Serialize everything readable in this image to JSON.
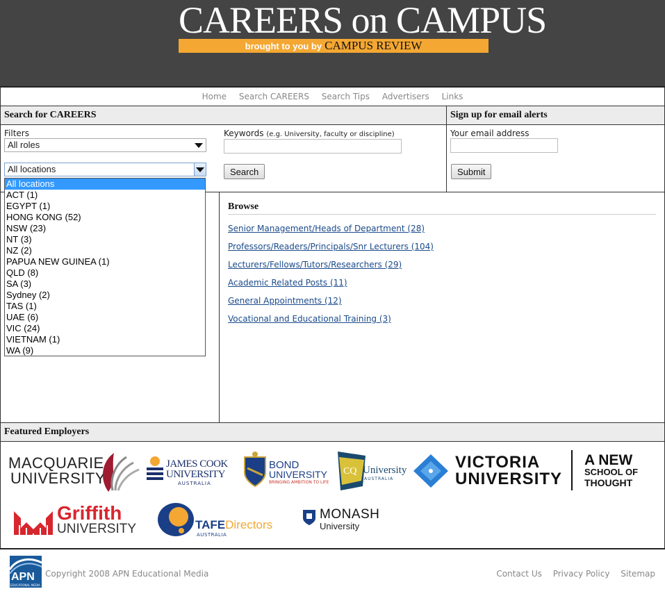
{
  "header": {
    "logo_title": "CAREERS on CAMPUS",
    "logo_subtitle": "brought to you by",
    "logo_brand": "CAMPUS REVIEW",
    "bg_color": "#444444",
    "bar_color": "#f4a732"
  },
  "nav": {
    "items": [
      "Home",
      "Search CAREERS",
      "Search Tips",
      "Advertisers",
      "Links"
    ]
  },
  "search": {
    "heading": "Search for CAREERS",
    "filters_label": "Filters",
    "roles_value": "All roles",
    "locations_value": "All locations",
    "keywords_label": "Keywords",
    "keywords_hint": "(e.g. University, faculty or discipline)",
    "keywords_value": "",
    "search_button": "Search",
    "location_options": [
      "All locations",
      "ACT (1)",
      "EGYPT (1)",
      "HONG KONG (52)",
      "NSW (23)",
      "NT (3)",
      "NZ (2)",
      "PAPUA NEW GUINEA (1)",
      "QLD (8)",
      "SA (3)",
      "Sydney (2)",
      "TAS (1)",
      "UAE (6)",
      "VIC (24)",
      "VIETNAM (1)",
      "WA (9)"
    ]
  },
  "alerts": {
    "heading": "Sign up for email alerts",
    "email_label": "Your email address",
    "email_value": "",
    "submit_button": "Submit"
  },
  "browse": {
    "heading": "Browse",
    "links": [
      "Senior Management/Heads of Department (28)",
      "Professors/Readers/Principals/Snr Lecturers (104)",
      "Lecturers/Fellows/Tutors/Researchers (29)",
      "Academic Related Posts (11)",
      "General Appointments (12)",
      "Vocational and Educational Training (3)"
    ]
  },
  "employers": {
    "heading": "Featured Employers",
    "macquarie": [
      "MACQUARIE",
      "UNIVERSITY"
    ],
    "jcu": [
      "JAMES COOK",
      "UNIVERSITY",
      "AUSTRALIA"
    ],
    "bond": [
      "BOND",
      "UNIVERSITY",
      "BRINGING AMBITION TO LIFE"
    ],
    "cqu": [
      "CQ",
      "University",
      "AUSTRALIA"
    ],
    "victoria": [
      "VICTORIA",
      "UNIVERSITY",
      "A NEW",
      "SCHOOL OF",
      "THOUGHT"
    ],
    "griffith": [
      "Griffith",
      "UNIVERSITY"
    ],
    "tafe": [
      "TAFE",
      "Directors",
      "AUSTRALIA"
    ],
    "monash": [
      "MONASH",
      "University"
    ]
  },
  "footer": {
    "apn_logo": "APN",
    "apn_logo_sub": "EDUCATIONAL MEDIA",
    "copyright": "Copyright 2008 APN Educational Media",
    "links": [
      "Contact Us",
      "Privacy Policy",
      "Sitemap"
    ]
  }
}
